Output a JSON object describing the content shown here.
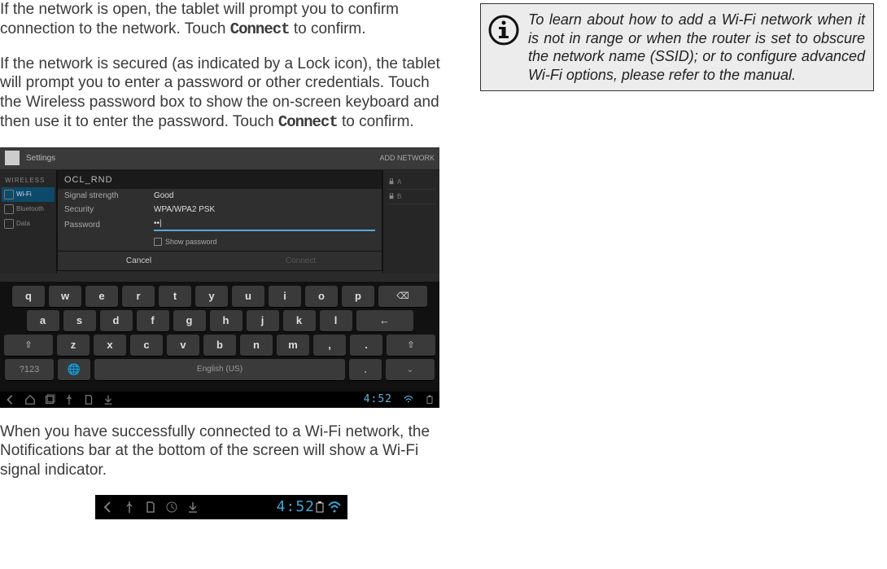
{
  "left": {
    "p1a": "If the network is open, the tablet will prompt you to confirm connection to the network. Touch ",
    "p1b": "Connect",
    "p1c": " to confirm.",
    "p2a": "If the network is secured (as indicated by a Lock icon), the tablet will prompt you to enter a password or other credentials.  Touch the Wireless password box to show the on-screen keyboard and then use it to enter the password. Touch ",
    "p2b": "Connect",
    "p2c": " to confirm.",
    "p3": "When you have successfully connected to a Wi-Fi network, the Notifications bar at the bottom of the screen will show a Wi-Fi signal indicator."
  },
  "callout": {
    "text": "To learn about how to add a Wi-Fi network when it is not in range or when the router is set to obscure the network name (SSID); or to configure advanced Wi-Fi options, please refer to the manual."
  },
  "shot": {
    "settings_label": "Settings",
    "add_network": "ADD NETWORK",
    "dialog_title": "OCL_RND",
    "signal_lbl": "Signal strength",
    "signal_val": "Good",
    "security_lbl": "Security",
    "security_val": "WPA/WPA2 PSK",
    "password_lbl": "Password",
    "password_val": "••|",
    "show_pwd": "Show password",
    "cancel": "Cancel",
    "connect": "Connect",
    "side_header": "WIRELESS",
    "side_wifi": "Wi-Fi",
    "side_blue": "Bluetooth",
    "side_data": "Data",
    "net_a": "A",
    "net_b": "B",
    "keys_r1": [
      "q",
      "w",
      "e",
      "r",
      "t",
      "y",
      "u",
      "i",
      "o",
      "p"
    ],
    "keys_r2": [
      "a",
      "s",
      "d",
      "f",
      "g",
      "h",
      "j",
      "k",
      "l"
    ],
    "keys_r3": [
      "z",
      "x",
      "c",
      "v",
      "b",
      "n",
      "m",
      ","
    ],
    "sym_key": "?123",
    "lang_key": "English (US)",
    "clock": "4:52",
    "clock2": "4:52"
  }
}
